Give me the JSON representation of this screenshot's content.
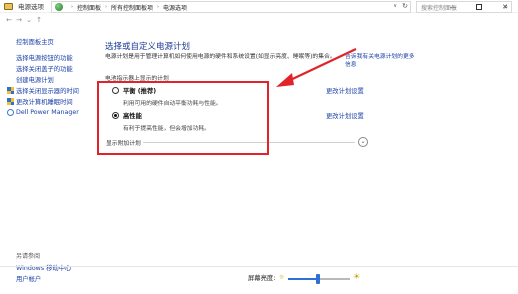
{
  "window": {
    "title": "电源选项",
    "min_glyph": "—",
    "close_glyph": "✕"
  },
  "address": {
    "back_glyph": "←",
    "forward_glyph": "→",
    "up_glyph": "↑",
    "crumbs": [
      "控制面板",
      "所有控制面板项",
      "电源选项"
    ],
    "sep_glyph": "›",
    "dropdown_glyph": "∨",
    "refresh_glyph": "↻"
  },
  "search": {
    "placeholder": "搜索控制面板",
    "icon_glyph": "⌕"
  },
  "leftnav": {
    "home": "控制面板主页",
    "links": [
      "选择电源按钮的功能",
      "选择关闭盖子的功能",
      "创建电源计划",
      "选择关闭显示器的时间",
      "更改计算机睡眠时间",
      "Dell Power Manager"
    ],
    "see_also": "另请参阅",
    "see_also_links": [
      "Windows 移动中心",
      "用户帐户"
    ]
  },
  "main": {
    "heading": "选择或自定义电源计划",
    "description": "电源计划是用于管理计算机如何使用电源的硬件和系统设置(如显示亮度、睡眠等)的集合。",
    "desc_link": "告诉我有关电源计划的更多信息",
    "section_label": "电池指示器上显示的计划",
    "plans": [
      {
        "name": "平衡 (推荐)",
        "sub": "利用可用的硬件自动平衡功耗与性能。",
        "link": "更改计划设置",
        "selected": false
      },
      {
        "name": "高性能",
        "sub": "有利于提高性能，但会增加功耗。",
        "link": "更改计划设置",
        "selected": true
      }
    ],
    "additional_label": "显示附加计划",
    "expander_glyph": "⌄"
  },
  "brightness": {
    "label": "屏幕亮度:",
    "value_fraction": 0.48,
    "sun_small": "☼",
    "sun_large": "☀"
  },
  "colors": {
    "link": "#1a3fa8",
    "heading": "#1c3d94",
    "annotation_red": "#e1232a",
    "accent_blue": "#2f6fd6"
  }
}
